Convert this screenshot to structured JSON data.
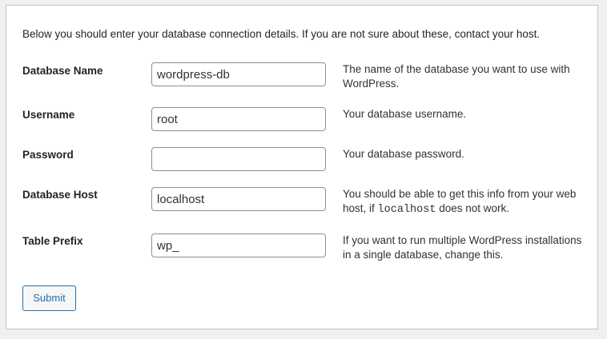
{
  "intro": "Below you should enter your database connection details. If you are not sure about these, contact your host.",
  "fields": [
    {
      "label": "Database Name",
      "value": "wordpress-db",
      "description": "The name of the database you want to use with WordPress."
    },
    {
      "label": "Username",
      "value": "root",
      "description": "Your database username."
    },
    {
      "label": "Password",
      "value": "",
      "description": "Your database password."
    },
    {
      "label": "Database Host",
      "value": "localhost",
      "description_before": "You should be able to get this info from your web host, if ",
      "description_code": "localhost",
      "description_after": " does not work."
    },
    {
      "label": "Table Prefix",
      "value": "wp_",
      "description": "If you want to run multiple WordPress installations in a single database, change this."
    }
  ],
  "submit_label": "Submit"
}
